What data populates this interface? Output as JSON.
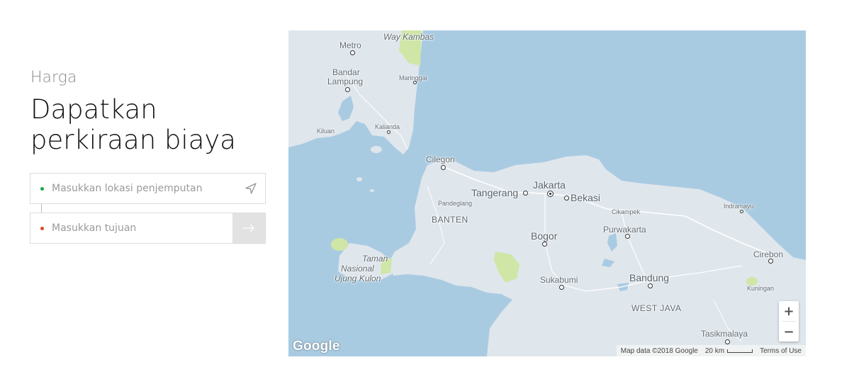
{
  "header": {
    "eyebrow": "Harga",
    "title_line1": "Dapatkan",
    "title_line2": "perkiraan biaya"
  },
  "form": {
    "pickup_placeholder": "Masukkan lokasi penjemputan",
    "destination_placeholder": "Masukkan tujuan",
    "locate_icon": "navigation-arrow-icon",
    "submit_icon": "arrow-right-icon"
  },
  "map": {
    "labels": {
      "way_kambas": "Way Kambas",
      "metro": "Metro",
      "bandar": "Bandar",
      "lampung": "Lampung",
      "maringgai": "Maringgai",
      "kiluan": "Kiluan",
      "kalianda": "Kalianda",
      "cilegon": "Cilegon",
      "tangerang": "Tangerang",
      "jakarta": "Jakarta",
      "bekasi": "Bekasi",
      "pandeglang": "Pandeglang",
      "banten": "BANTEN",
      "cikampek": "Cikampek",
      "indramayu": "Indramayu",
      "purwakarta": "Purwakarta",
      "bogor": "Bogor",
      "cirebon": "Cirebon",
      "taman": "Taman",
      "nasional": "Nasional",
      "ujung_kulon": "Ujung Kulon",
      "sukabumi": "Sukabumi",
      "bandung": "Bandung",
      "kuningan": "Kuningan",
      "west_java": "WEST JAVA",
      "tasikmalaya": "Tasikmalaya"
    },
    "zoom_in": "+",
    "zoom_out": "−",
    "logo": "Google",
    "attribution": "Map data ©2018 Google",
    "scale": "20 km",
    "terms": "Terms of Use",
    "colors": {
      "water": "#a9cbe2",
      "land": "#dfe6ec",
      "park": "#cfe6a6"
    }
  }
}
